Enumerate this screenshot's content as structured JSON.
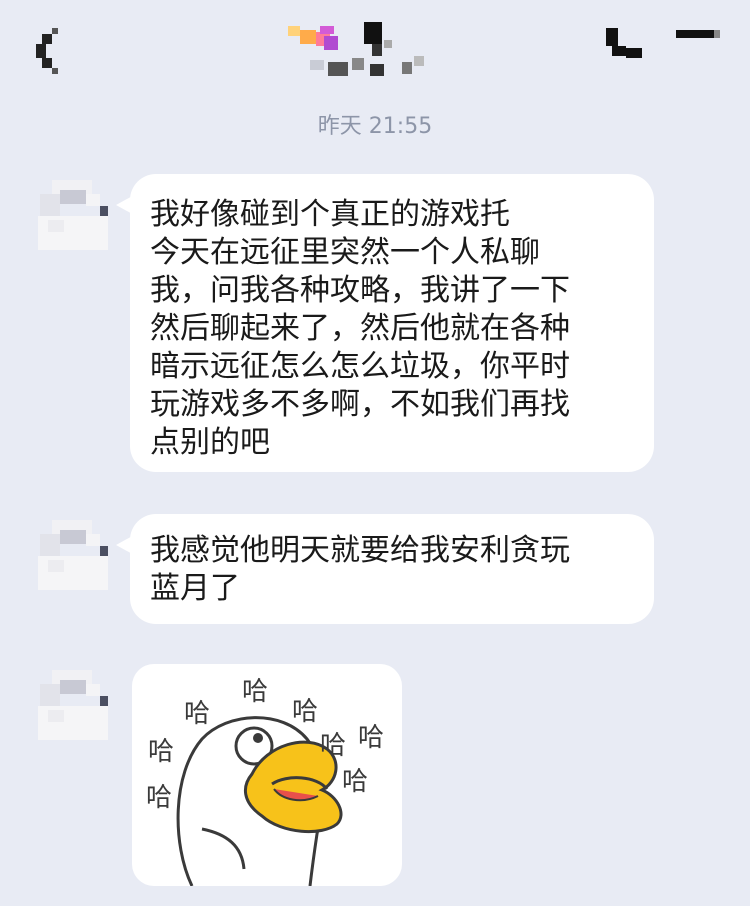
{
  "header": {
    "back_icon": "chevron-left-icon",
    "title_obscured": true,
    "call_icon": "phone-icon",
    "menu_icon": "menu-icon"
  },
  "timestamp": "昨天 21:55",
  "messages": [
    {
      "lines": [
        "我好像碰到个真正的游戏托",
        "今天在远征里突然一个人私聊",
        "我，问我各种攻略，我讲了一下",
        "然后聊起来了，然后他就在各种",
        "暗示远征怎么怎么垃圾，你平时",
        "玩游戏多不多啊，不如我们再找",
        "点别的吧"
      ]
    },
    {
      "lines": [
        "我感觉他明天就要给我安利贪玩",
        "蓝月了"
      ]
    }
  ],
  "sticker": {
    "text": [
      "哈",
      "哈",
      "哈",
      "哈",
      "哈",
      "哈",
      "哈",
      "哈"
    ],
    "description_icon": "laughing-duck-sticker"
  },
  "colors": {
    "background": "#e8ebf4",
    "bubble": "#ffffff",
    "timestamp": "#8d95a8",
    "duck_beak": "#f7c21a"
  }
}
